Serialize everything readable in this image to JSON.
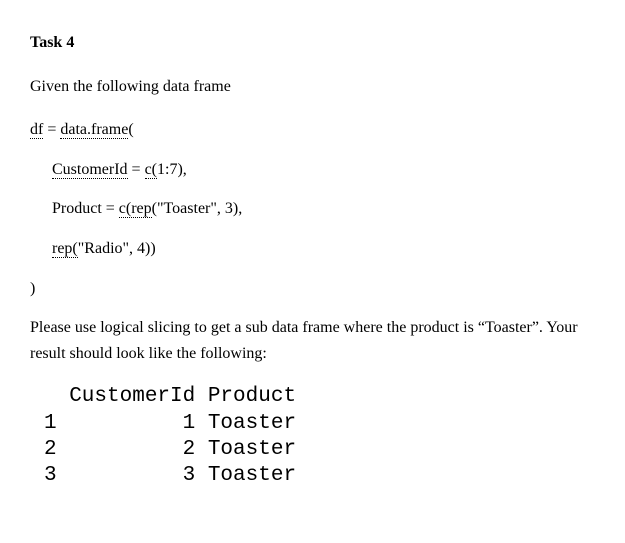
{
  "title": "Task 4",
  "intro": "Given the following data frame",
  "code": {
    "l1a": "df",
    "l1b": " = ",
    "l1c": "data.frame",
    "l1d": "(",
    "l2a": "CustomerId",
    "l2b": " = ",
    "l2c": "c(",
    "l2d": "1:7),",
    "l3a": "Product = ",
    "l3b": "c(rep",
    "l3c": "(\"Toaster\", 3),",
    "l4a": "rep(",
    "l4b": "\"Radio\", 4))",
    "l5": ")"
  },
  "instruction": "Please use logical slicing to get a sub data frame where the product is “Toaster”. Your result should look like the following:",
  "chart_data": {
    "type": "table",
    "columns": [
      "",
      "CustomerId",
      "Product"
    ],
    "rows": [
      {
        "index": "1",
        "CustomerId": "1",
        "Product": "Toaster"
      },
      {
        "index": "2",
        "CustomerId": "2",
        "Product": "Toaster"
      },
      {
        "index": "3",
        "CustomerId": "3",
        "Product": "Toaster"
      }
    ]
  },
  "output": {
    "header": "  CustomerId Product",
    "r1": "1          1 Toaster",
    "r2": "2          2 Toaster",
    "r3": "3          3 Toaster"
  }
}
